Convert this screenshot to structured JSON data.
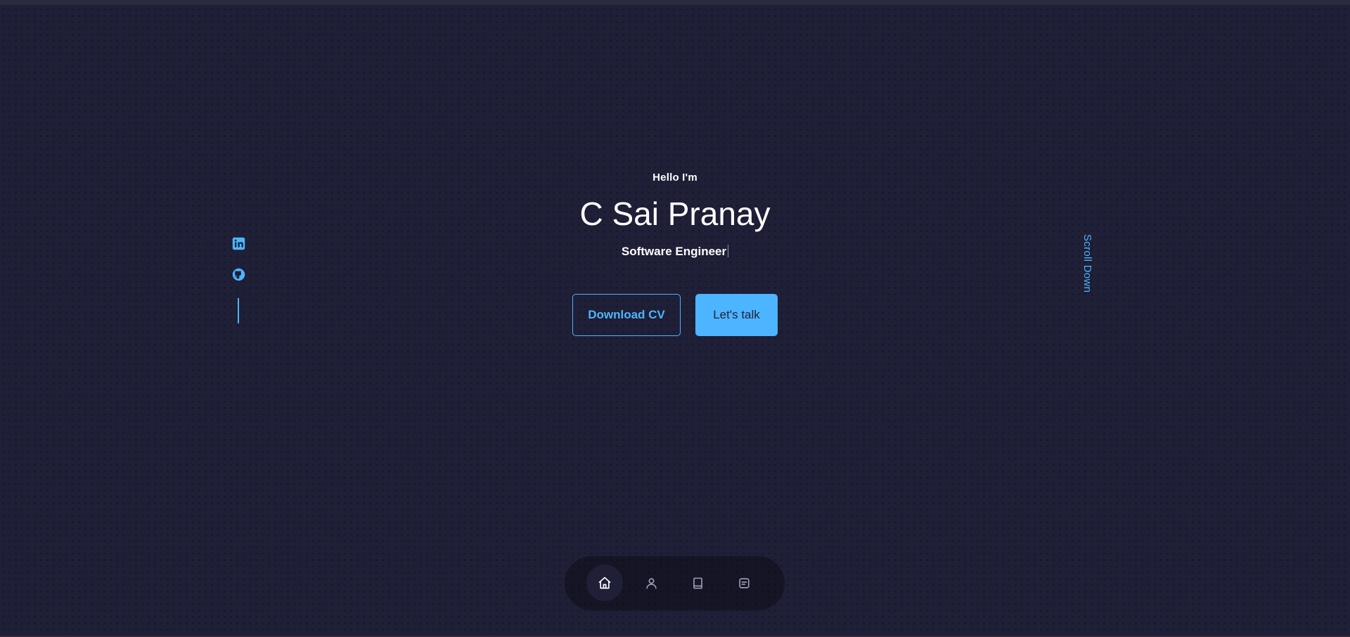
{
  "hero": {
    "greeting": "Hello I'm",
    "name": "C Sai Pranay",
    "role": "Software Engineer"
  },
  "buttons": {
    "download_cv": "Download CV",
    "lets_talk": "Let's talk"
  },
  "socials": [
    {
      "icon": "linkedin-icon"
    },
    {
      "icon": "github-icon"
    }
  ],
  "scroll_down": "Scroll Down",
  "nav": {
    "items": [
      {
        "icon": "home-icon",
        "active": true
      },
      {
        "icon": "user-icon",
        "active": false
      },
      {
        "icon": "book-icon",
        "active": false
      },
      {
        "icon": "message-icon",
        "active": false
      }
    ]
  },
  "colors": {
    "background": "#1f1f37",
    "accent": "#4db5ff",
    "text": "#ffffff"
  }
}
